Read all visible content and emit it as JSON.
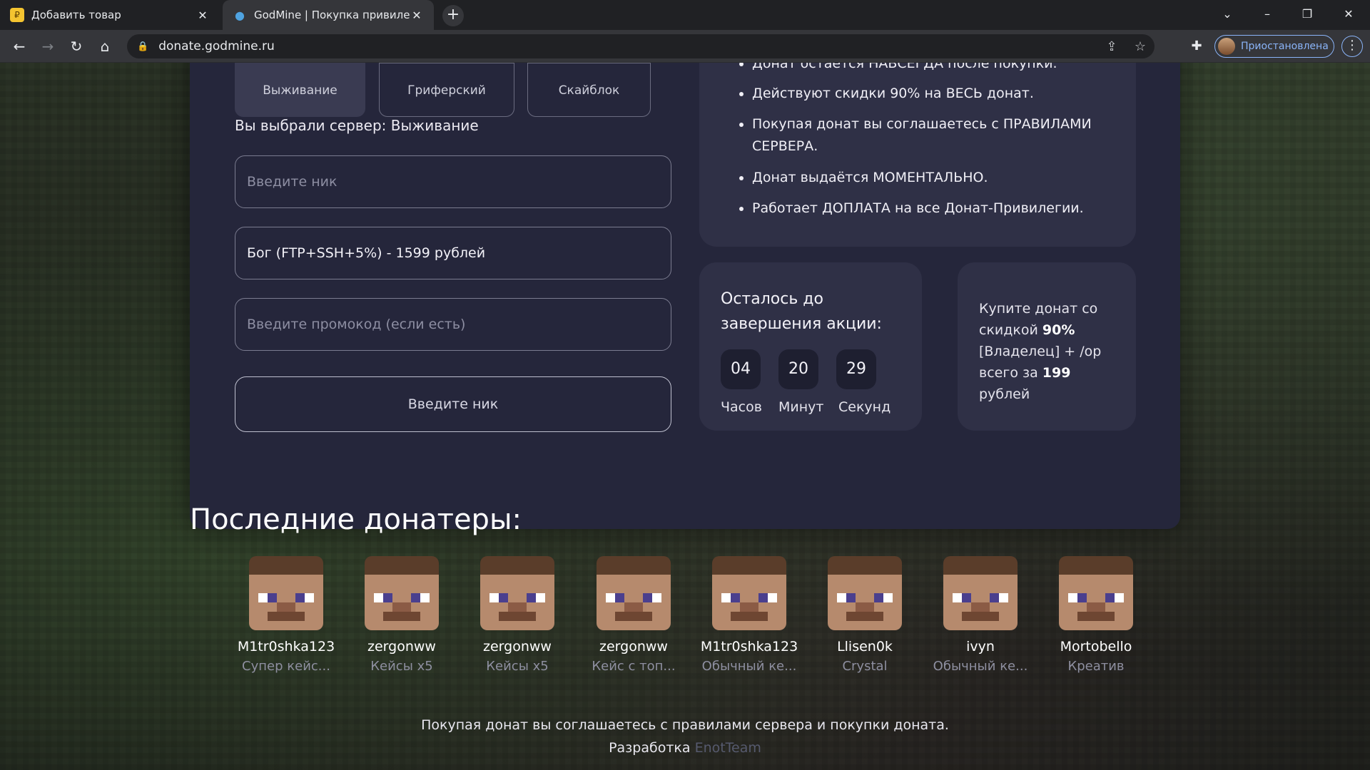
{
  "browser": {
    "tabs": [
      {
        "title": "Добавить товар",
        "favicon": "coin-icon"
      },
      {
        "title": "GodMine | Покупка привилегий",
        "favicon": "site-icon"
      }
    ],
    "url": "donate.godmine.ru",
    "profile_label": "Приостановлена"
  },
  "form": {
    "servers": [
      "Выживание",
      "Гриферский",
      "Скайблок"
    ],
    "selected_server": "Вы выбрали сервер: Выживание",
    "nick_placeholder": "Введите ник",
    "selected_privilege": "Бог (FTP+SSH+5%) - 1599 рублей",
    "promo_placeholder": "Введите промокод (если есть)",
    "submit_label": "Введите ник"
  },
  "info": {
    "items": [
      "Донат остается НАВСЕГДА после покупки.",
      "Действуют скидки 90% на ВЕСЬ донат.",
      "Покупая донат вы соглашаетесь с ПРАВИЛАМИ СЕРВЕРА.",
      "Донат выдаётся МОМЕНТАЛЬНО.",
      "Работает ДОПЛАТА на все Донат-Привилегии."
    ]
  },
  "timer": {
    "title": "Осталось до завершения акции:",
    "hours": "04",
    "minutes": "20",
    "seconds": "29",
    "hours_label": "Часов",
    "minutes_label": "Минут",
    "seconds_label": "Секунд"
  },
  "promo": {
    "line1": "Купите донат со скидкой",
    "discount": "90%",
    "line2": "[Владелец] + /op всего за",
    "price": "199",
    "line3": "рублей"
  },
  "donors": {
    "title": "Последние донатеры:",
    "list": [
      {
        "nick": "M1tr0shka123",
        "item": "Супер кейс..."
      },
      {
        "nick": "zergonww",
        "item": "Кейсы x5"
      },
      {
        "nick": "zergonww",
        "item": "Кейсы x5"
      },
      {
        "nick": "zergonww",
        "item": "Кейс с топ..."
      },
      {
        "nick": "M1tr0shka123",
        "item": "Обычный ке..."
      },
      {
        "nick": "Llisen0k",
        "item": "Crystal"
      },
      {
        "nick": "ivyn",
        "item": "Обычный ке..."
      },
      {
        "nick": "Mortobello",
        "item": "Креатив"
      }
    ]
  },
  "footer": {
    "agreement": "Покупая донат вы соглашаетесь с правилами сервера и покупки доната.",
    "dev_prefix": "Разработка",
    "dev_name": "EnotTeam"
  }
}
